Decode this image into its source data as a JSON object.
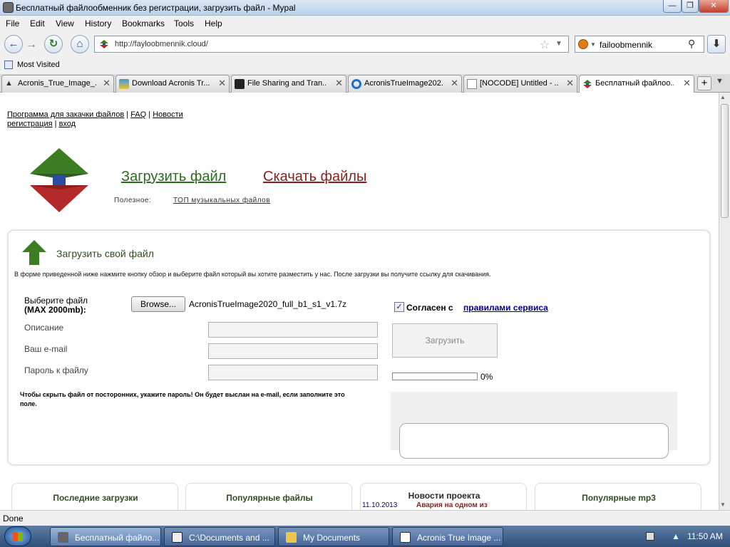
{
  "window": {
    "title": "Бесплатный файлообменник без регистрации, загрузить файл - Mypal",
    "minimize": "—",
    "maximize": "❐",
    "close": "✕"
  },
  "menu": [
    "File",
    "Edit",
    "View",
    "History",
    "Bookmarks",
    "Tools",
    "Help"
  ],
  "nav": {
    "url": "http://fayloobmennik.cloud/",
    "search_value": "failoobmennik"
  },
  "bookmarks": {
    "most_visited": "Most Visited"
  },
  "tabs": [
    {
      "label": "Acronis_True_Image_..."
    },
    {
      "label": "Download Acronis Tr..."
    },
    {
      "label": "File Sharing and Tran..."
    },
    {
      "label": "AcronisTrueImage202..."
    },
    {
      "label": "[NOCODE] Untitled - ..."
    },
    {
      "label": "Бесплатный файлоо..."
    }
  ],
  "page": {
    "toplinks": {
      "download_program": "Программа для закачки файлов",
      "faq": "FAQ",
      "news": "Новости",
      "register": "регистрация",
      "login": "вход"
    },
    "nav_upload": "Загрузить файл",
    "nav_download": "Скачать файлы",
    "useful_label": "Полезное:",
    "top_music": "ТОП музыкальных файлов",
    "upload_heading": "Загрузить свой файл",
    "instructions": "В форме приведенной ниже нажмите кнопку обзор и выберите файл который вы хотите разместить у нас. После загрузки вы получите ссылку для скачивания.",
    "choose_file": "Выберите файл",
    "max_size": "(MAX 2000mb):",
    "browse": "Browse...",
    "filename": "AcronisTrueImage2020_full_b1_s1_v1.7z",
    "description_label": "Описание",
    "email_label": "Ваш e-mail",
    "password_label": "Пароль к файлу",
    "agree_text": "Согласен с",
    "rules_link": "правилами сервиса",
    "agree_checked": true,
    "upload_button": "Загрузить",
    "progress_text": "0%",
    "progress": 0,
    "password_note": "Чтобы скрыть файл от посторонних, укажите пароль! Он будет выслан на e-mail, если заполните это поле.",
    "boxes": {
      "latest": "Последние загрузки",
      "popular": "Популярные файлы",
      "news": "Новости проекта",
      "news_date": "11.10.2013",
      "news_title": "Авария на одном из",
      "mp3": "Популярные mp3"
    }
  },
  "status": "Done",
  "taskbar": {
    "tasks": [
      {
        "label": "Бесплатный файло..."
      },
      {
        "label": "C:\\Documents and ..."
      },
      {
        "label": "My Documents"
      },
      {
        "label": "Acronis True Image ..."
      }
    ],
    "clock": "11:50 AM"
  },
  "colors": {
    "green_link": "#2d6b1e",
    "red_link": "#8b1f1f",
    "heading_green": "#2f4f1f",
    "rules_link": "#00008b",
    "taskbar": "#2f4e78"
  }
}
